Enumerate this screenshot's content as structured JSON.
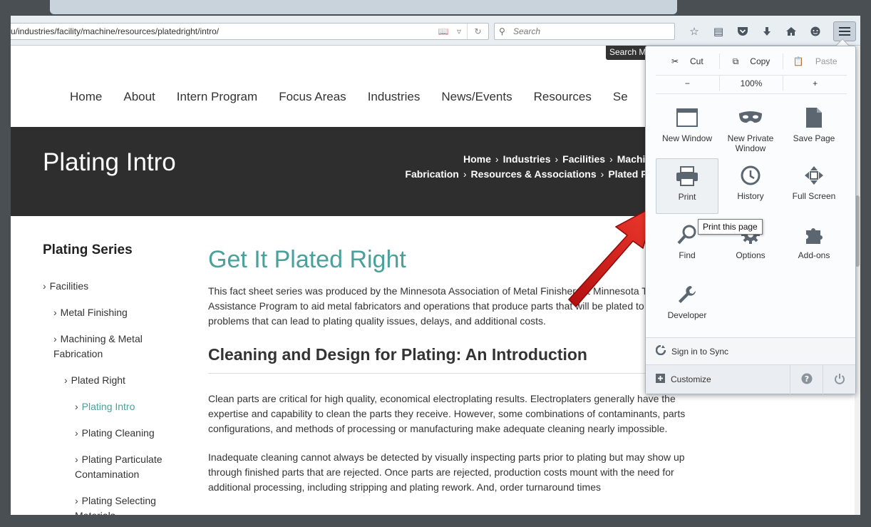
{
  "browser": {
    "url": "u/industries/facility/machine/resources/platedright/intro/",
    "search_placeholder": "Search"
  },
  "site": {
    "search_tab": "Search M",
    "nav": [
      "Home",
      "About",
      "Intern Program",
      "Focus Areas",
      "Industries",
      "News/Events",
      "Resources",
      "Se"
    ]
  },
  "hero": {
    "title": "Plating Intro",
    "crumbs_line1": [
      "Home",
      "Industries",
      "Facilities",
      "Machining"
    ],
    "crumbs_line2": [
      "Fabrication",
      "Resources & Associations",
      "Plated Right"
    ]
  },
  "sidebar": {
    "heading": "Plating Series",
    "items": [
      {
        "label": "Facilities"
      },
      {
        "label": "Metal Finishing"
      },
      {
        "label": "Machining & Metal\nFabrication"
      },
      {
        "label": "Plated Right"
      },
      {
        "label": "Plating Intro"
      },
      {
        "label": "Plating Cleaning"
      },
      {
        "label": "Plating Particulate\nContamination"
      },
      {
        "label": "Plating Selecting\nMaterials"
      }
    ]
  },
  "content": {
    "title": "Get It Plated Right",
    "intro": "This fact sheet series was produced by the Minnesota Association of Metal Finishers & Minnesota Technical Assistance Program to aid metal fabricators and operations that produce parts that will be plated to avoid problems that can lead to plating quality issues, delays, and additional costs.",
    "section_title": "Cleaning and Design for Plating: An Introduction",
    "para1": "Clean parts are critical for high quality, economical electroplating results. Electroplaters generally have the expertise and capability to clean the parts they receive. However, some combinations of contaminants, parts configurations, and methods of processing or manufacturing make adequate cleaning nearly impossible.",
    "para2": "Inadequate cleaning cannot always be detected by visually inspecting parts prior to plating but may show up through finished parts that are rejected. Once parts are rejected, production costs mount with the need for additional processing, including stripping and plating rework. And, order turnaround times"
  },
  "menu": {
    "cut": "Cut",
    "copy": "Copy",
    "paste": "Paste",
    "zoom_out": "−",
    "zoom_level": "100%",
    "zoom_in": "+",
    "new_window": "New Window",
    "new_private_window": "New Private Window",
    "save_page": "Save Page",
    "print": "Print",
    "history": "History",
    "full_screen": "Full Screen",
    "find": "Find",
    "options": "Options",
    "addons": "Add-ons",
    "developer": "Developer",
    "sync": "Sign in to Sync",
    "customize": "Customize",
    "tooltip": "Print this page"
  },
  "colors": {
    "accent_teal": "#4aa09a",
    "hero_bg": "#2e2e2e",
    "arrow_red": "#e52222"
  }
}
